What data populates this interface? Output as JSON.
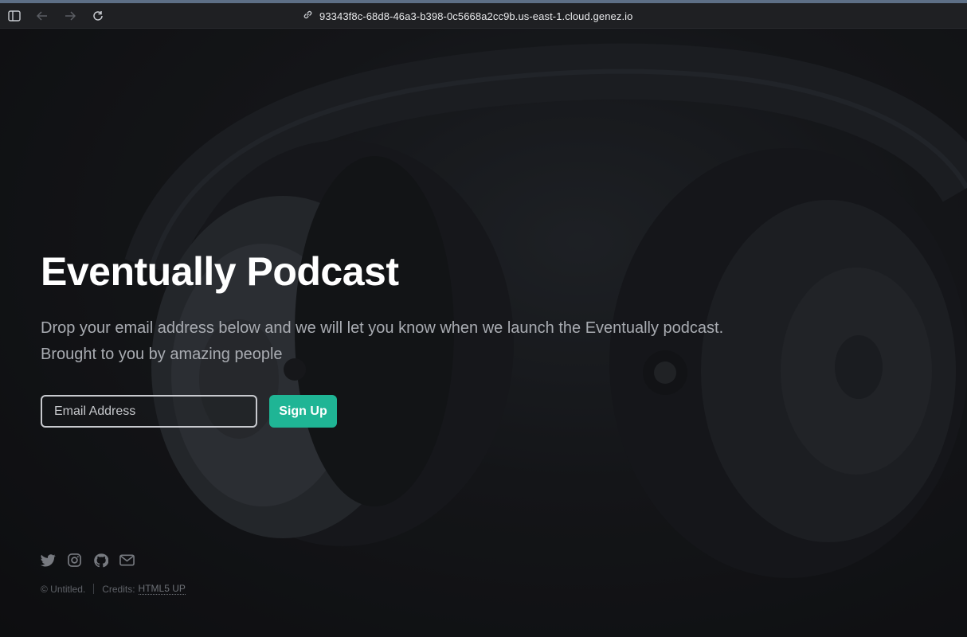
{
  "browser": {
    "url": "93343f8c-68d8-46a3-b398-0c5668a2cc9b.us-east-1.cloud.genez.io",
    "icons": [
      "sidebar-icon",
      "back-arrow-icon",
      "forward-arrow-icon",
      "reload-icon",
      "link-icon"
    ]
  },
  "hero": {
    "title": "Eventually Podcast",
    "description_line1": "Drop your email address below and we will let you know when we launch the Eventually podcast.",
    "description_line2": "Brought to you by amazing people",
    "background": "headphones-photo"
  },
  "form": {
    "email_placeholder": "Email Address",
    "email_value": "",
    "submit_label": "Sign Up"
  },
  "social": {
    "icons": [
      "twitter-icon",
      "instagram-icon",
      "github-icon",
      "envelope-icon"
    ]
  },
  "footer": {
    "copyright": "© Untitled.",
    "credits_label": "Credits:",
    "credits_link": "HTML5 UP"
  },
  "colors": {
    "accent": "#1fb595",
    "background": "#111214",
    "title": "#ffffff",
    "body_text": "#a9acb2"
  }
}
